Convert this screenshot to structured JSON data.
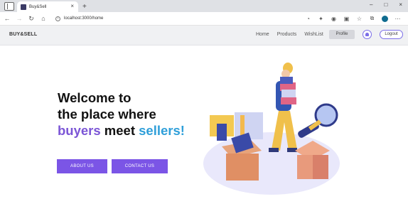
{
  "browser": {
    "tab_title": "Buy&Sell",
    "tab_close": "×",
    "new_tab": "+",
    "url": "localhost:3000/home",
    "win_minimize": "–",
    "win_maximize": "□",
    "win_close": "×"
  },
  "navbar": {
    "brand": "BUY&SELL",
    "links": [
      "Home",
      "Products",
      "WishList"
    ],
    "profile_label": "Profile",
    "logout_label": "Logout"
  },
  "hero": {
    "line1": "Welcome to",
    "line2": "the place where",
    "line3_part1": "buyers",
    "line3_part2": " meet ",
    "line3_part3": "sellers!"
  },
  "buttons": {
    "about": "ABOUT US",
    "contact": "CONTACT US"
  },
  "colors": {
    "accent": "#7b55e6",
    "buyers": "#7b55d6",
    "sellers": "#2f9fd9"
  }
}
